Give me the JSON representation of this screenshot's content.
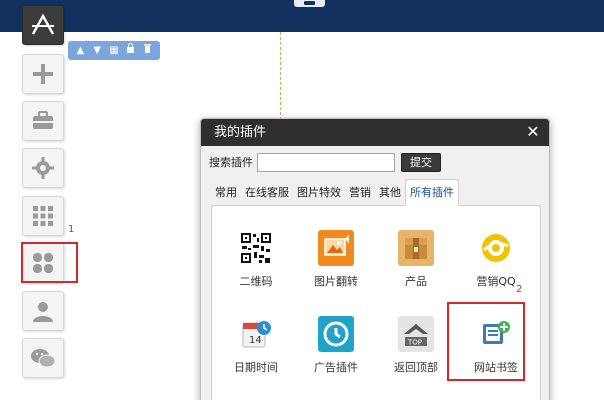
{
  "sidebar": {
    "items": [
      {
        "name": "logo-icon"
      },
      {
        "name": "add-icon"
      },
      {
        "name": "toolbox-icon"
      },
      {
        "name": "gear-icon"
      },
      {
        "name": "grid-icon"
      },
      {
        "name": "plugin-clover-icon"
      },
      {
        "name": "user-icon"
      },
      {
        "name": "wechat-icon"
      }
    ]
  },
  "mini_toolbar": {
    "icons": [
      "chevron-up-icon",
      "chevron-down-icon",
      "layout-icon",
      "lock-icon",
      "trash-icon"
    ],
    "glyphs": [
      "▲",
      "▼",
      "▦",
      "🔒",
      "🗑"
    ]
  },
  "annotations": {
    "box1_label": "1",
    "box2_label": "2",
    "color": "#d9262a"
  },
  "dialog": {
    "title": "我的插件",
    "close_glyph": "✕",
    "search": {
      "label": "搜索插件",
      "value": "",
      "placeholder": "",
      "button": "提交"
    },
    "tabs": [
      {
        "label": "常用",
        "active": false
      },
      {
        "label": "在线客服",
        "active": false
      },
      {
        "label": "图片特效",
        "active": false
      },
      {
        "label": "营销",
        "active": false
      },
      {
        "label": "其他",
        "active": false
      },
      {
        "label": "所有插件",
        "active": true
      }
    ],
    "plugins": [
      {
        "label": "二维码",
        "icon": "qrcode-icon"
      },
      {
        "label": "图片翻转",
        "icon": "image-flip-icon"
      },
      {
        "label": "产品",
        "icon": "product-box-icon"
      },
      {
        "label": "营销QQ",
        "icon": "qq-marketing-icon"
      },
      {
        "label": "日期时间",
        "icon": "calendar-clock-icon"
      },
      {
        "label": "广告插件",
        "icon": "ad-plugin-icon"
      },
      {
        "label": "返回顶部",
        "icon": "back-to-top-icon"
      },
      {
        "label": "网站书签",
        "icon": "bookmark-add-icon"
      }
    ]
  },
  "colors": {
    "topbar": "#12315f",
    "accent_blue": "#7aa6dc",
    "highlight_red": "#d9262a"
  }
}
